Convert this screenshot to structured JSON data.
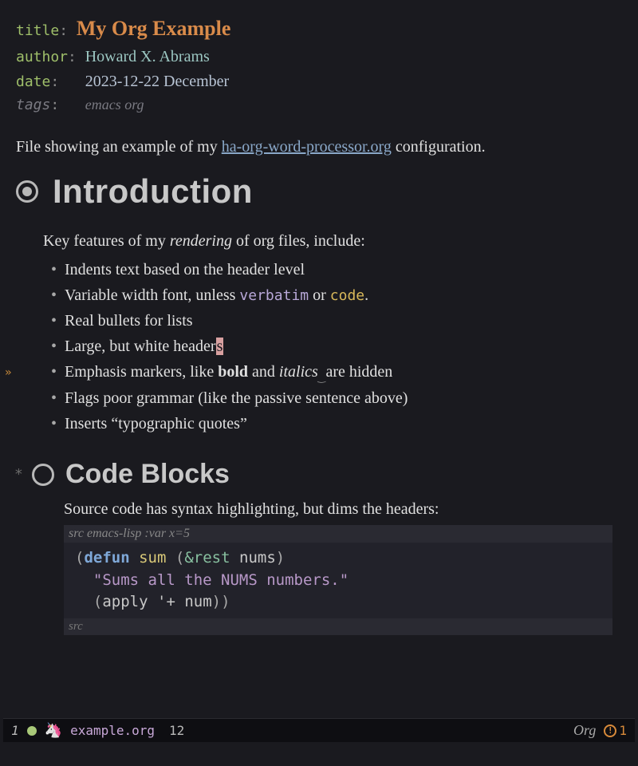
{
  "meta": {
    "title_key": "title",
    "title_val": "My Org Example",
    "author_key": "author",
    "author_val": "Howard X. Abrams",
    "date_key": "date",
    "date_val": "2023-12-22 December",
    "tags_key": "tags",
    "tags_val": "emacs org"
  },
  "intro_text_pre": "File showing an example of my ",
  "intro_link": "ha-org-word-processor.org",
  "intro_text_post": " configuration.",
  "sections": {
    "intro": {
      "heading": "Introduction",
      "lead_pre": "Key features of my ",
      "lead_em": "rendering",
      "lead_post": " of org files, include:",
      "items": [
        {
          "text": "Indents text based on the header level"
        },
        {
          "pre": "Variable width font, unless ",
          "verbatim": "verbatim",
          "mid": " or ",
          "code": "code",
          "post": "."
        },
        {
          "text": "Real bullets for lists"
        },
        {
          "pre": "Large, but white header",
          "cursor": "s"
        },
        {
          "pre": "Emphasis markers, like ",
          "bold": "bold",
          "mid": " and ",
          "ital": "italics",
          "post": "are hidden"
        },
        {
          "text": "Flags poor grammar (like the passive sentence above)"
        },
        {
          "text": "Inserts “typographic quotes”"
        }
      ]
    },
    "code": {
      "star": "*",
      "heading": "Code Blocks",
      "lead": "Source code has syntax highlighting, but dims the headers:",
      "src_header_kw": "src",
      "src_header_rest": " emacs-lisp :var x=5",
      "src_footer": "src",
      "code_lines": {
        "l1_open": "(",
        "l1_defun": "defun",
        "l1_sp": " ",
        "l1_name": "sum",
        "l1_sp2": " ",
        "l1_op": "(",
        "l1_amp": "&rest",
        "l1_sp3": " ",
        "l1_arg": "nums",
        "l1_cl": ")",
        "l2_str": "\"Sums all the NUMS numbers.\"",
        "l3_open": "(",
        "l3_apply": "apply",
        "l3_sp": " ",
        "l3_quote": "'+",
        "l3_sp2": " ",
        "l3_arg": "num",
        "l3_close": "))"
      }
    }
  },
  "modeline": {
    "window_num": "1",
    "filename": "example.org",
    "line": "12",
    "mode": "Org",
    "warn_count": "1"
  }
}
